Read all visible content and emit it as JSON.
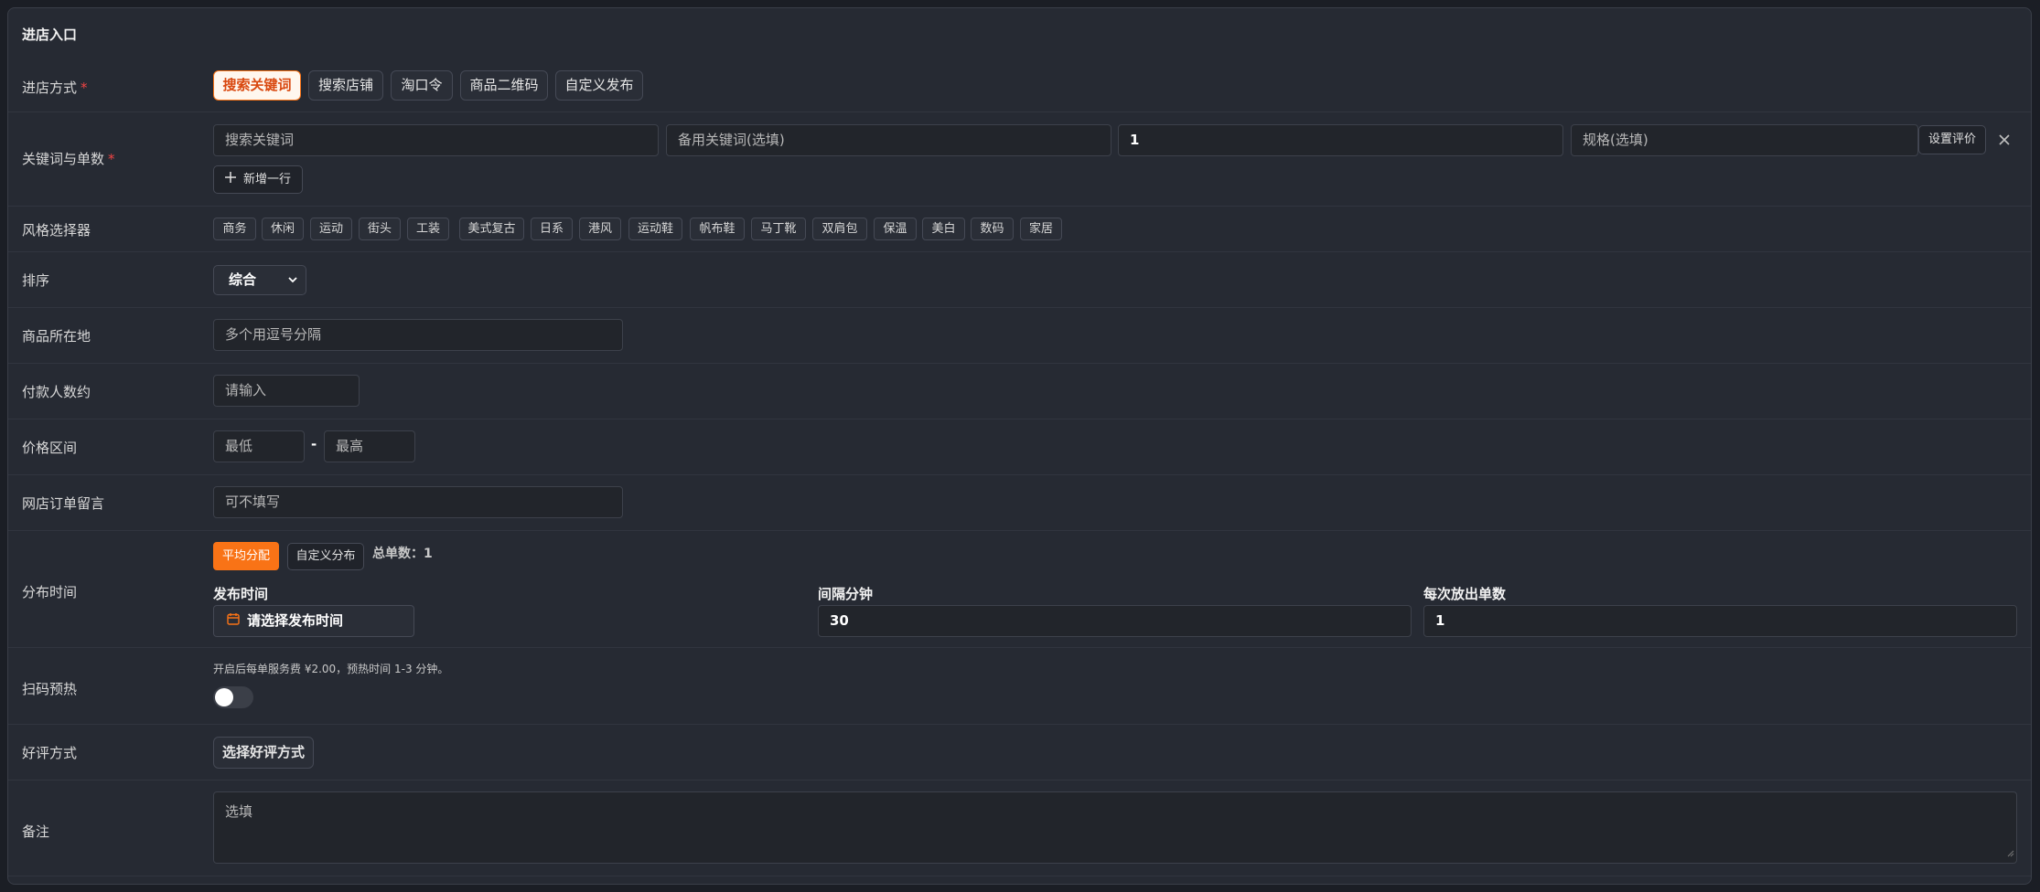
{
  "panel": {
    "title": "进店入口"
  },
  "entry": {
    "label": "进店方式",
    "required_mark": "*",
    "options": [
      "搜索关键词",
      "搜索店铺",
      "淘口令",
      "商品二维码",
      "自定义发布"
    ],
    "selected": "搜索关键词"
  },
  "keywords": {
    "label": "关键词与单数",
    "required_mark": "*",
    "keyword_placeholder": "搜索关键词",
    "backup_placeholder": "备用关键词(选填)",
    "count_value": "1",
    "spec_placeholder": "规格(选填)",
    "review_button": "设置评价",
    "remove_icon": "close-icon",
    "add_row_button": "新增一行",
    "add_icon": "plus-icon"
  },
  "style": {
    "label": "风格选择器",
    "tags": [
      "商务",
      "休闲",
      "运动",
      "街头",
      "工装",
      "美式复古",
      "日系",
      "港风",
      "运动鞋",
      "帆布鞋",
      "马丁靴",
      "双肩包",
      "保温",
      "美白",
      "数码",
      "家居"
    ]
  },
  "sort": {
    "label": "排序",
    "selected": "综合"
  },
  "location": {
    "label": "商品所在地",
    "placeholder": "多个用逗号分隔"
  },
  "payers": {
    "label": "付款人数约",
    "placeholder": "请输入"
  },
  "price": {
    "label": "价格区间",
    "min_placeholder": "最低",
    "separator": "-",
    "max_placeholder": "最高"
  },
  "message": {
    "label": "网店订单留言",
    "placeholder": "可不填写"
  },
  "distribution": {
    "label": "分布时间",
    "even_button": "平均分配",
    "custom_button": "自定义分布",
    "total_text": "总单数：1",
    "publish_label": "发布时间",
    "publish_placeholder": "请选择发布时间",
    "calendar_icon": "calendar-icon",
    "interval_label": "间隔分钟",
    "interval_value": "30",
    "per_batch_label": "每次放出单数",
    "per_batch_value": "1"
  },
  "preheat": {
    "label": "扫码预热",
    "hint": "开启后每单服务费 ¥2.00，预热时间 1-3 分钟。",
    "enabled": false
  },
  "review_method": {
    "label": "好评方式",
    "button": "选择好评方式"
  },
  "note": {
    "label": "备注",
    "placeholder": "选填"
  },
  "colors": {
    "accent": "#f97316",
    "required": "#ef4444",
    "background": "#262a33"
  }
}
